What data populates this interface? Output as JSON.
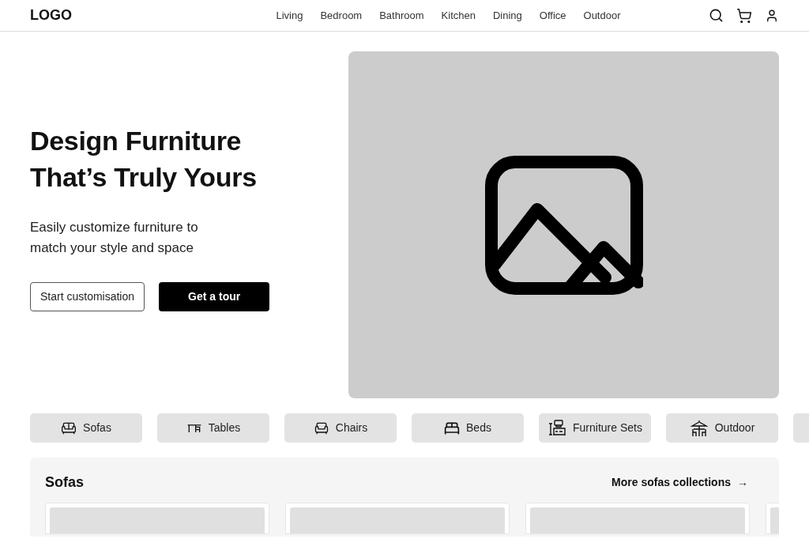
{
  "header": {
    "logo": "LOGO",
    "nav": [
      {
        "label": "Living"
      },
      {
        "label": "Bedroom"
      },
      {
        "label": "Bathroom"
      },
      {
        "label": "Kitchen"
      },
      {
        "label": "Dining"
      },
      {
        "label": "Office"
      },
      {
        "label": "Outdoor"
      }
    ]
  },
  "hero": {
    "title_lines": [
      "Design Furniture",
      "That’s Truly Yours"
    ],
    "subtitle_lines": [
      "Easily customize furniture to",
      "match your style and space"
    ],
    "buttons": [
      {
        "label": "Start customisation",
        "kind": "outline"
      },
      {
        "label": "Get a tour",
        "kind": "solid"
      }
    ],
    "image": {
      "kind": "placeholder"
    }
  },
  "categories": [
    {
      "label": "Sofas",
      "kind": "sofa"
    },
    {
      "label": "Tables",
      "kind": "table"
    },
    {
      "label": "Chairs",
      "kind": "chair"
    },
    {
      "label": "Beds",
      "kind": "bed"
    },
    {
      "label": "Furniture Sets",
      "kind": "sets"
    },
    {
      "label": "Outdoor",
      "kind": "outdoor"
    },
    {
      "kind": "cut"
    }
  ],
  "section": {
    "title": "Sofas",
    "link": "More sofas collections",
    "link_arrow": "→",
    "cards": [
      {
        "kind": "placeholder"
      },
      {
        "kind": "placeholder"
      },
      {
        "kind": "placeholder"
      },
      {
        "kind": "cut"
      }
    ]
  }
}
